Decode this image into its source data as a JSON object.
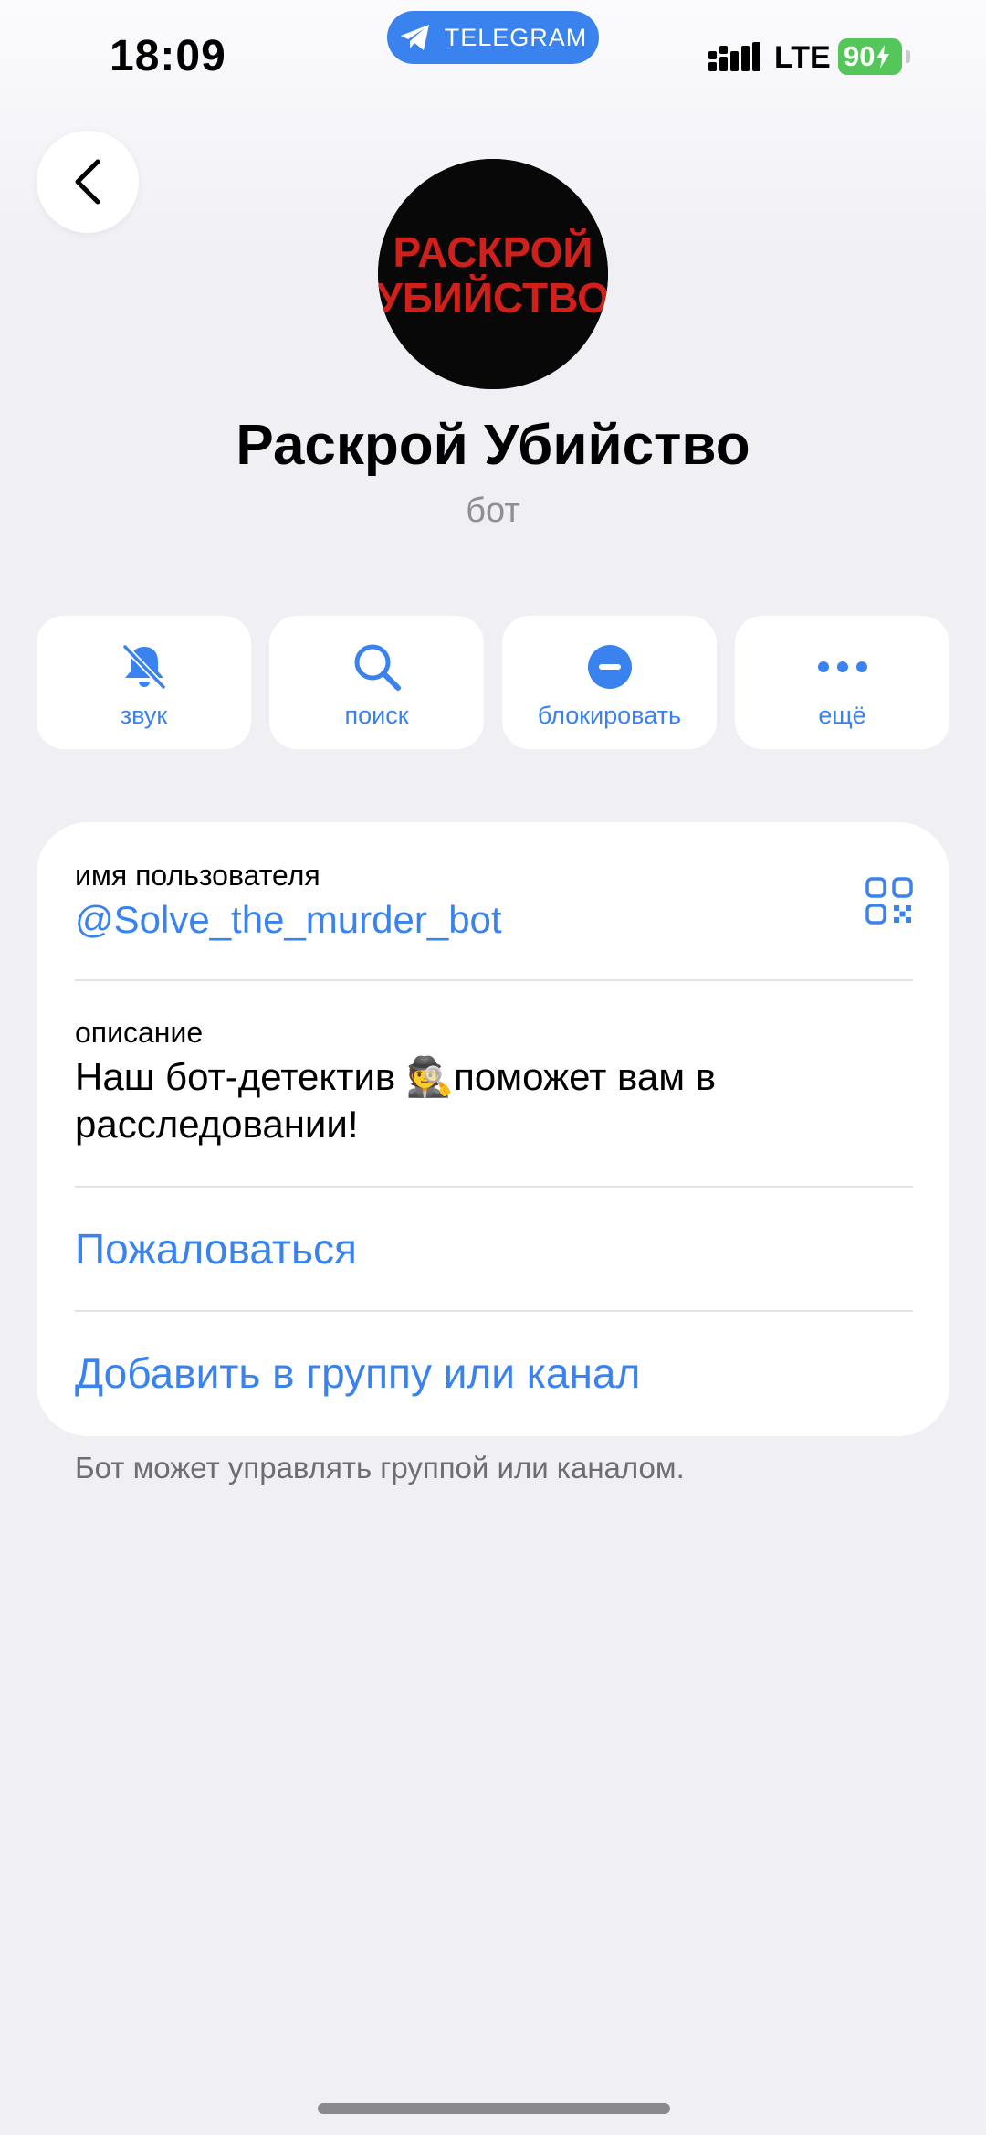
{
  "status_bar": {
    "time": "18:09",
    "app_pill": "TELEGRAM",
    "network": "LTE",
    "battery": "90"
  },
  "profile": {
    "avatar_text_line1": "РАСКРОЙ",
    "avatar_text_line2": "УБИЙСТВО",
    "name": "Раскрой Убийство",
    "type": "бот"
  },
  "actions": [
    {
      "label": "звук",
      "icon": "bell-muted-icon"
    },
    {
      "label": "поиск",
      "icon": "search-icon"
    },
    {
      "label": "блокировать",
      "icon": "block-icon"
    },
    {
      "label": "ещё",
      "icon": "more-icon"
    }
  ],
  "info": {
    "username_caption": "имя пользователя",
    "username": "@Solve_the_murder_bot",
    "description_caption": "описание",
    "description_line1": "Наш бот-детектив 🕵️поможет вам в",
    "description_line2": "расследовании!",
    "report_label": "Пожаловаться",
    "add_label": "Добавить в группу или канал"
  },
  "footnote": "Бот может управлять группой или каналом.",
  "colors": {
    "accent": "#3a82ee",
    "background": "#efeff4",
    "battery": "#54c65a"
  }
}
